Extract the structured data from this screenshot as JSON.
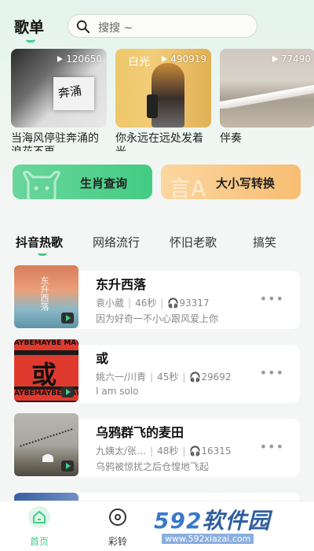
{
  "header": {
    "title": "歌单",
    "search_placeholder": "搜搜 ~"
  },
  "playlists": [
    {
      "name": "当海风停驻奔涌的浪花不再…",
      "plays": "120650",
      "cover_text": "奔涌"
    },
    {
      "name": "你永远在远处发着光",
      "plays": "490919",
      "cover_text": "白光"
    },
    {
      "name": "伴奏",
      "plays": "77490"
    }
  ],
  "quick_actions": [
    {
      "label": "生肖查询",
      "color": "#4ccd88"
    },
    {
      "label": "大小写转换",
      "color": "#f8c27c"
    }
  ],
  "tabs": [
    {
      "label": "抖音热歌",
      "active": true
    },
    {
      "label": "网络流行",
      "active": false
    },
    {
      "label": "怀旧老歌",
      "active": false
    },
    {
      "label": "搞笑",
      "active": false
    }
  ],
  "songs": [
    {
      "title": "东升西落",
      "artist": "袁小葳",
      "duration": "46秒",
      "plays": "93317",
      "desc": "因为好奇一不小心跟风爱上你",
      "cover_text": "东升西落"
    },
    {
      "title": "或",
      "artist": "姚六一/川青",
      "duration": "45秒",
      "plays": "29692",
      "desc": "I am solo",
      "cover_text": "或",
      "cover_band": "AYBEMAYBE MAYBE"
    },
    {
      "title": "乌鸦群飞的麦田",
      "artist": "九姨太/张…",
      "duration": "48秒",
      "plays": "16315",
      "desc": "乌鸦被惊扰之后仓惶地飞起"
    }
  ],
  "bottom_nav": [
    {
      "label": "首页",
      "active": true
    },
    {
      "label": "彩铃",
      "active": false
    }
  ],
  "watermark": {
    "text_num": "592",
    "text_cn": "软件园",
    "url": "www.592xiazai.com"
  },
  "colors": {
    "accent": "#3fcf8a",
    "text_primary": "#111111",
    "text_secondary": "#888888"
  }
}
